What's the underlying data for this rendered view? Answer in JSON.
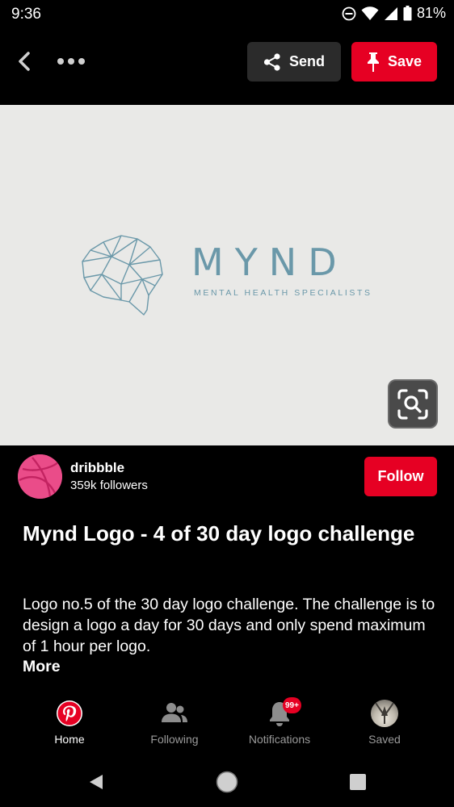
{
  "status_bar": {
    "time": "9:36",
    "battery_percent": "81%",
    "icons": [
      "dnd-icon",
      "wifi-icon",
      "signal-icon",
      "battery-icon"
    ]
  },
  "top_bar": {
    "send_label": "Send",
    "save_label": "Save",
    "icons": [
      "back-arrow-icon",
      "more-dots-icon",
      "share-icon",
      "pin-icon"
    ]
  },
  "pin": {
    "logo_word": "MYND",
    "logo_tagline": "MENTAL HEALTH SPECIALISTS",
    "title": "Mynd Logo - 4 of 30 day logo challenge",
    "description": "Logo no.5 of the 30 day logo challenge. The challenge is to design a logo a day for 30 days and only spend maximum of 1 hour per logo.",
    "more_label": "More"
  },
  "creator": {
    "name": "dribbble",
    "followers": "359k followers",
    "follow_label": "Follow"
  },
  "bottom_nav": {
    "items": [
      {
        "label": "Home",
        "icon": "pinterest-icon",
        "active": true
      },
      {
        "label": "Following",
        "icon": "people-icon",
        "active": false
      },
      {
        "label": "Notifications",
        "icon": "bell-icon",
        "active": false,
        "badge": "99+"
      },
      {
        "label": "Saved",
        "icon": "avatar",
        "active": false
      }
    ]
  },
  "colors": {
    "brand_red": "#e60023",
    "logo_blue": "#6a98a9",
    "dribbble_pink": "#ea4c89"
  }
}
